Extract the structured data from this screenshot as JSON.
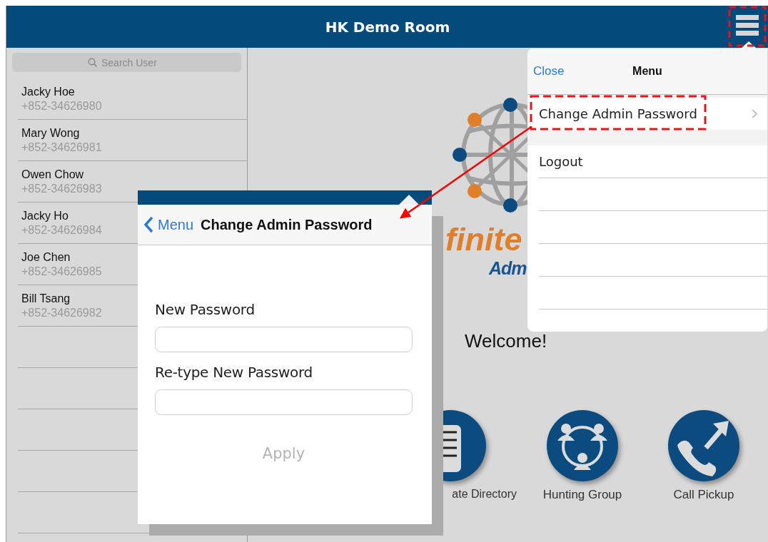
{
  "header": {
    "title": "HK Demo Room"
  },
  "sidebar": {
    "search": {
      "placeholder": "Search User"
    },
    "users": [
      {
        "name": "Jacky Hoe",
        "phone": "+852-34626980"
      },
      {
        "name": "Mary Wong",
        "phone": "+852-34626981"
      },
      {
        "name": "Owen Chow",
        "phone": "+852-34626983"
      },
      {
        "name": "Jacky Ho",
        "phone": "+852-34626984"
      },
      {
        "name": "Joe Chen",
        "phone": "+852-34626985"
      },
      {
        "name": "Bill Tsang",
        "phone": "+852-34626982"
      }
    ]
  },
  "main": {
    "logo": {
      "text_1": "finite",
      "text_2": "Adm"
    },
    "welcome": "Welcome!",
    "tiles": [
      {
        "label": "ate Directory",
        "kind": "directory"
      },
      {
        "label": "Hunting Group",
        "kind": "group"
      },
      {
        "label": "Call Pickup",
        "kind": "pickup"
      }
    ]
  },
  "menu_popover": {
    "close": "Close",
    "title": "Menu",
    "items": [
      {
        "label": "Change Admin Password",
        "kind": "link"
      },
      {
        "label": "Logout",
        "kind": "plain"
      }
    ]
  },
  "password_popover": {
    "back": "Menu",
    "title": "Change Admin Password",
    "fields": [
      {
        "label": "New Password"
      },
      {
        "label": "Re-type New Password"
      }
    ],
    "apply": {
      "label": "Apply",
      "disabled": true
    }
  }
}
